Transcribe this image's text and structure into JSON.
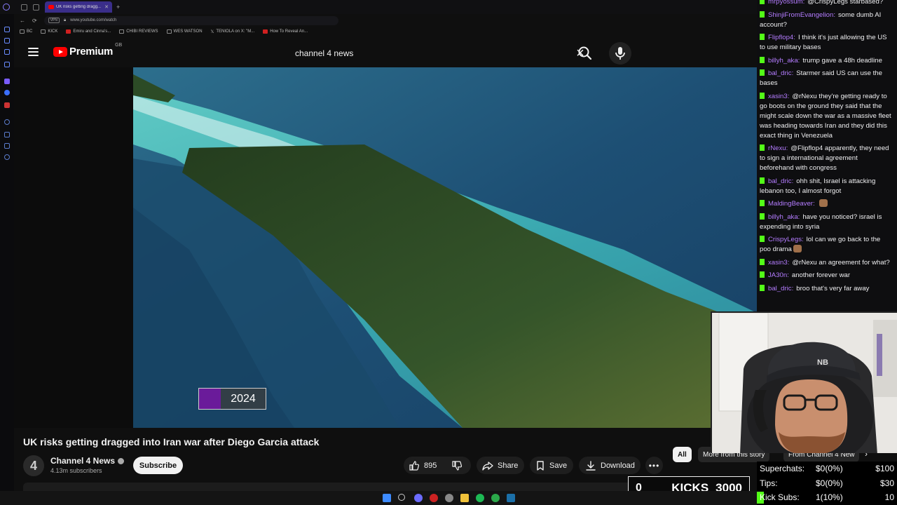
{
  "browser": {
    "tab_title": "UK risks getting dragg...",
    "url": "www.youtube.com/watch",
    "vpn_label": "VPN",
    "bookmarks": [
      "BC",
      "KICK",
      "Emiru and Cinna's...",
      "CHIBI REVIEWS",
      "WES WATSON",
      "TENIOLA on X: \"M...",
      "How To Reveal An..."
    ]
  },
  "youtube": {
    "brand": "Premium",
    "region": "GB",
    "search_query": "channel 4 news",
    "video": {
      "title": "UK risks getting dragged into Iran war after Diego Garcia attack",
      "year_badge": "2024",
      "badge_color": "#6a1b9a"
    },
    "channel": {
      "name": "Channel 4 News",
      "avatar_glyph": "4",
      "subscribers": "4.13m subscribers",
      "subscribe_label": "Subscribe"
    },
    "actions": {
      "likes": "895",
      "share": "Share",
      "save": "Save",
      "download": "Download",
      "more": "•••"
    },
    "chips": [
      "All",
      "More from this story",
      "From Channel 4 New"
    ]
  },
  "chat": {
    "messages": [
      {
        "user": "mrpyossum:",
        "text": "@CrispyLegs starbased?"
      },
      {
        "user": "ShinjiFromEvangelion:",
        "text": "some dumb AI account?"
      },
      {
        "user": "Flipflop4:",
        "text": "I think it's just allowing the US to use military bases"
      },
      {
        "user": "billyh_aka:",
        "text": "trump gave a 48h deadline"
      },
      {
        "user": "bal_dric:",
        "text": "Starmer said US can use the bases"
      },
      {
        "user": "xasin3:",
        "text": "@rNexu they're getting ready to go boots on the ground they said that the might scale down the war as a massive fleet was heading towards Iran and they did this exact thing in Venezuela"
      },
      {
        "user": "rNexu:",
        "text": "@Flipflop4 apparently, they need to sign a international agreement beforehand with congress"
      },
      {
        "user": "bal_dric:",
        "text": "ohh shit, Israel is attacking lebanon too, I almost forgot"
      },
      {
        "user": "MaldingBeaver:",
        "text": ""
      },
      {
        "user": "billyh_aka:",
        "text": "have you noticed? israel is expending into syria"
      },
      {
        "user": "CrispyLegs:",
        "text": "lol can we go back to the poo drama"
      },
      {
        "user": "xasin3:",
        "text": "@rNexu an agreement for what?"
      },
      {
        "user": "JA30n:",
        "text": "another forever war"
      },
      {
        "user": "bal_dric:",
        "text": "broo that's very far away"
      }
    ]
  },
  "overlay": {
    "kicks_count": "0",
    "kicks_label": "KICKS",
    "kicks_goal": "3000",
    "accent": "#53fc18",
    "stats": [
      {
        "label": "Superchats:",
        "value": "$0(0%)",
        "goal": "$100"
      },
      {
        "label": "Tips:",
        "value": "$0(0%)",
        "goal": "$30"
      },
      {
        "label": "Kick Subs:",
        "value": "1(10%)",
        "goal": "10"
      }
    ]
  }
}
